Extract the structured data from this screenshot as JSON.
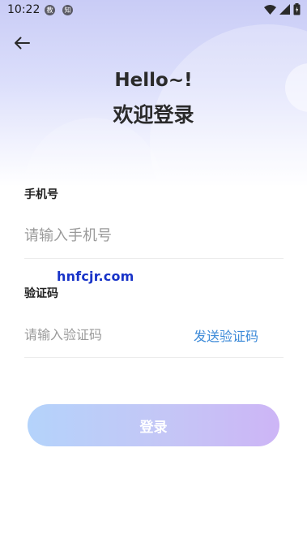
{
  "status_bar": {
    "time": "10:22",
    "notif1": "教",
    "notif2": "知"
  },
  "header": {
    "back_icon": "arrow-left-icon",
    "greeting": "Hello~!",
    "welcome": "欢迎登录"
  },
  "form": {
    "phone_label": "手机号",
    "phone_placeholder": "请输入手机号",
    "code_label": "验证码",
    "code_placeholder": "请输入验证码",
    "send_code": "发送验证码"
  },
  "login_button": "登录",
  "watermark": "hnfcjr.com",
  "colors": {
    "accent_link": "#3c8ad8",
    "button_gradient_start": "#b4d3fb",
    "button_gradient_end": "#cdb5f6",
    "header_bg": "#c9ccf6"
  }
}
